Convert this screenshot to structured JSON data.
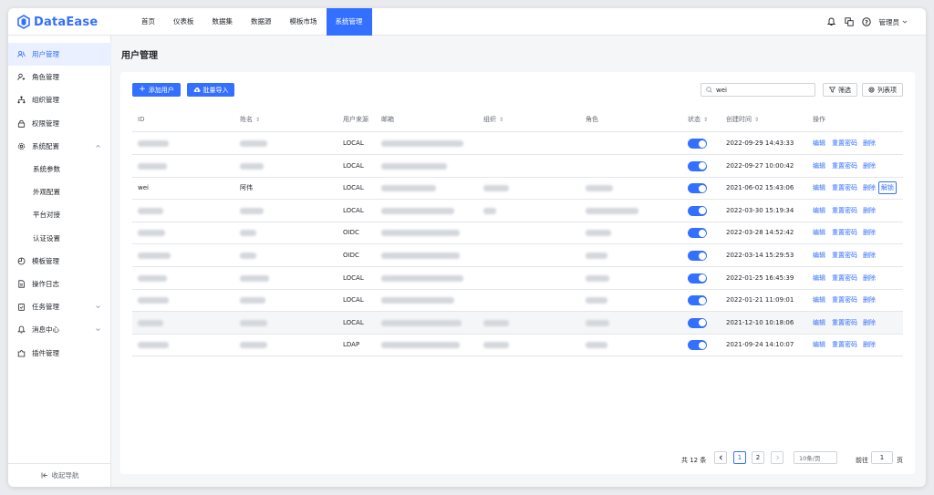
{
  "app": {
    "logo_text": "DataEase",
    "brand_color": "#3370ff"
  },
  "topnav": {
    "items": [
      {
        "label": "首页"
      },
      {
        "label": "仪表板"
      },
      {
        "label": "数据集"
      },
      {
        "label": "数据源"
      },
      {
        "label": "模板市场"
      },
      {
        "label": "系统管理",
        "active": true
      }
    ],
    "icons": [
      "bell-icon",
      "translate-icon",
      "help-icon"
    ],
    "user_label": "管理员"
  },
  "sidebar": {
    "items": [
      {
        "label": "用户管理",
        "icon": "users-icon",
        "active": true
      },
      {
        "label": "角色管理",
        "icon": "role-icon"
      },
      {
        "label": "组织管理",
        "icon": "org-icon"
      },
      {
        "label": "权限管理",
        "icon": "lock-icon"
      },
      {
        "label": "系统配置",
        "icon": "gear-icon",
        "expanded": true
      },
      {
        "label": "系统参数",
        "sub": true
      },
      {
        "label": "外观配置",
        "sub": true
      },
      {
        "label": "平台对接",
        "sub": true
      },
      {
        "label": "认证设置",
        "sub": true
      },
      {
        "label": "模板管理",
        "icon": "template-icon"
      },
      {
        "label": "操作日志",
        "icon": "log-icon"
      },
      {
        "label": "任务管理",
        "icon": "task-icon",
        "collapsed": true
      },
      {
        "label": "消息中心",
        "icon": "bell-icon",
        "collapsed": true
      },
      {
        "label": "插件管理",
        "icon": "plugin-icon"
      }
    ],
    "collapse_label": "收起导航"
  },
  "page": {
    "title": "用户管理",
    "add_user_label": "添加用户",
    "batch_import_label": "批量导入",
    "search_value": "wei",
    "filter_label": "筛选",
    "columns_label": "列表项"
  },
  "table": {
    "headers": {
      "id": "ID",
      "name": "姓名",
      "source": "用户来源",
      "email": "邮箱",
      "org": "组织",
      "role": "角色",
      "status": "状态",
      "created": "创建时间",
      "ops": "操作"
    },
    "action_labels": {
      "edit": "编辑",
      "reset": "重置密码",
      "delete": "删除",
      "unlock": "解锁"
    },
    "rows": [
      {
        "id": "",
        "name": "",
        "source": "LOCAL",
        "email": "",
        "org": "",
        "role": "",
        "enabled": true,
        "created": "2022-09-29 14:43:33"
      },
      {
        "id": "",
        "name": "",
        "source": "LOCAL",
        "email": "",
        "org": "",
        "role": "",
        "enabled": true,
        "created": "2022-09-27 10:00:42"
      },
      {
        "id": "wei",
        "name": "阿伟",
        "source": "LOCAL",
        "email": "",
        "org": "",
        "role": "",
        "enabled": true,
        "created": "2021-06-02 15:43:06",
        "locked": true
      },
      {
        "id": "",
        "name": "",
        "source": "LOCAL",
        "email": "",
        "org": "",
        "role": "",
        "enabled": true,
        "created": "2022-03-30 15:19:34"
      },
      {
        "id": "",
        "name": "",
        "source": "OIDC",
        "email": "",
        "org": "",
        "role": "",
        "enabled": true,
        "created": "2022-03-28 14:52:42"
      },
      {
        "id": "",
        "name": "",
        "source": "OIDC",
        "email": "",
        "org": "",
        "role": "",
        "enabled": true,
        "created": "2022-03-14 15:29:53"
      },
      {
        "id": "",
        "name": "",
        "source": "LOCAL",
        "email": "",
        "org": "",
        "role": "",
        "enabled": true,
        "created": "2022-01-25 16:45:39"
      },
      {
        "id": "",
        "name": "",
        "source": "LOCAL",
        "email": "",
        "org": "",
        "role": "",
        "enabled": true,
        "created": "2022-01-21 11:09:01"
      },
      {
        "id": "",
        "name": "",
        "source": "LOCAL",
        "email": "",
        "org": "",
        "role": "",
        "enabled": true,
        "created": "2021-12-10 10:18:06",
        "highlighted": true
      },
      {
        "id": "",
        "name": "",
        "source": "LDAP",
        "email": "",
        "org": "",
        "role": "",
        "enabled": true,
        "created": "2021-09-24 14:10:07"
      }
    ]
  },
  "pagination": {
    "total_label": "共 12 条",
    "pages": [
      "1",
      "2"
    ],
    "current_page": "1",
    "page_size_label": "10条/页",
    "goto_label": "前往",
    "goto_value": "1",
    "page_unit": "页"
  }
}
